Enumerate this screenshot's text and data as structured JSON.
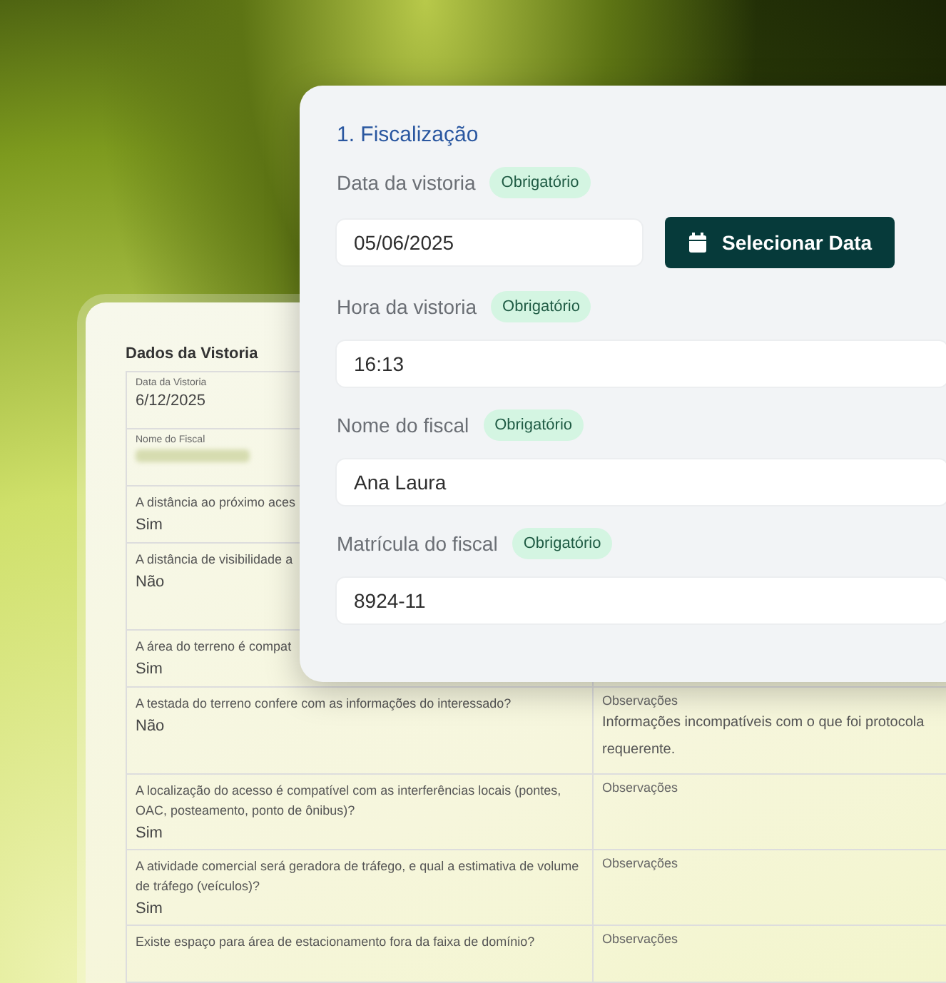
{
  "back_card": {
    "title": "Dados da Vistoria",
    "rows": [
      {
        "kind": "small",
        "label": "Data da Vistoria",
        "value": "6/12/2025"
      },
      {
        "kind": "redacted",
        "label": "Nome do Fiscal"
      },
      {
        "kind": "question",
        "label": "A distância ao próximo aces",
        "value": "Sim"
      },
      {
        "kind": "question",
        "label": "A distância de visibilidade a",
        "value": "Não",
        "tall": true
      },
      {
        "kind": "question",
        "label": "A área do terreno é compat",
        "value": "Sim"
      },
      {
        "kind": "question",
        "label": "A testada do terreno confere com as informações do interessado?",
        "value": "Não",
        "notes_label": "Observações",
        "notes": [
          "Informações incompatíveis com o que foi protocola",
          "requerente."
        ]
      },
      {
        "kind": "question",
        "label": "A localização do acesso é compatível com as interferências locais (pontes, OAC, posteamento, ponto de ônibus)?",
        "value": "Sim",
        "notes_label": "Observações"
      },
      {
        "kind": "question",
        "label": "A atividade comercial será geradora de tráfego, e qual a estimativa de volume de tráfego (veículos)?",
        "value": "Sim",
        "notes_label": "Observações"
      },
      {
        "kind": "question",
        "label": "Existe espaço para área de estacionamento fora da faixa de domínio?",
        "notes_label": "Observações"
      }
    ]
  },
  "form_card": {
    "section_title": "1. Fiscalização",
    "fields": [
      {
        "label": "Data da vistoria",
        "badge": "Obrigatório",
        "value": "05/06/2025",
        "button": "Selecionar Data"
      },
      {
        "label": "Hora da vistoria",
        "badge": "Obrigatório",
        "value": "16:13"
      },
      {
        "label": "Nome do fiscal",
        "badge": "Obrigatório",
        "value": "Ana Laura"
      },
      {
        "label": "Matrícula do fiscal",
        "badge": "Obrigatório",
        "value": "8924-11"
      }
    ]
  }
}
